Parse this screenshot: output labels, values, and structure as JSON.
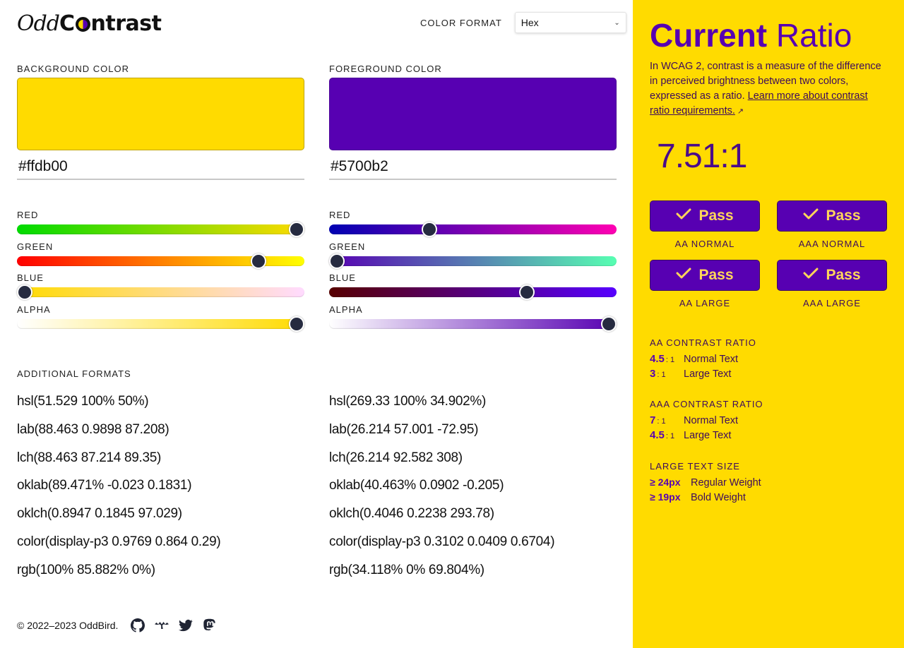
{
  "header": {
    "logo_part1": "Odd",
    "logo_part2_pre": "C",
    "logo_part2_post": "ntrast",
    "color_format_label": "COLOR FORMAT",
    "color_format_selected": "Hex"
  },
  "background": {
    "title": "BACKGROUND COLOR",
    "swatch_color": "#ffdb00",
    "hex_value": "#ffdb00",
    "sliders": [
      {
        "label": "RED",
        "value": 1.0,
        "gradient": [
          "#00db00",
          "#ffdb00"
        ]
      },
      {
        "label": "GREEN",
        "value": 0.859,
        "gradient": [
          "#ff0000",
          "#ffff00"
        ]
      },
      {
        "label": "BLUE",
        "value": 0.0,
        "gradient": [
          "#ffdb00",
          "#ffdbff"
        ]
      },
      {
        "label": "ALPHA",
        "value": 1.0,
        "gradient": [
          "rgba(255,219,0,0)",
          "#ffdb00"
        ]
      }
    ],
    "formats": [
      "hsl(51.529 100% 50%)",
      "lab(88.463 0.9898 87.208)",
      "lch(88.463 87.214 89.35)",
      "oklab(89.471% -0.023 0.1831)",
      "oklch(0.8947 0.1845 97.029)",
      "color(display-p3 0.9769 0.864 0.29)",
      "rgb(100% 85.882% 0%)"
    ]
  },
  "foreground": {
    "title": "FOREGROUND COLOR",
    "swatch_color": "#5700b2",
    "hex_value": "#5700b2",
    "sliders": [
      {
        "label": "RED",
        "value": 0.341,
        "gradient": [
          "#0000b2",
          "#ff00b2"
        ]
      },
      {
        "label": "GREEN",
        "value": 0.0,
        "gradient": [
          "#5700b2",
          "#57ffb2"
        ]
      },
      {
        "label": "BLUE",
        "value": 0.698,
        "gradient": [
          "#570000",
          "#5700ff"
        ]
      },
      {
        "label": "ALPHA",
        "value": 1.0,
        "gradient": [
          "rgba(87,0,178,0)",
          "#5700b2"
        ]
      }
    ],
    "formats": [
      "hsl(269.33 100% 34.902%)",
      "lab(26.214 57.001 -72.95)",
      "lch(26.214 92.582 308)",
      "oklab(40.463% 0.0902 -0.205)",
      "oklch(0.4046 0.2238 293.78)",
      "color(display-p3 0.3102 0.0409 0.6704)",
      "rgb(34.118% 0% 69.804%)"
    ]
  },
  "additional_formats_title": "ADDITIONAL FORMATS",
  "footer": {
    "copyright": "© 2022–2023 OddBird.",
    "icons": [
      "github-icon",
      "oddbird-icon",
      "twitter-icon",
      "mastodon-icon"
    ]
  },
  "sidebar": {
    "title_bold": "Current",
    "title_light": "Ratio",
    "description": "In WCAG 2, contrast is a measure of the difference in perceived brightness between two colors, expressed as a ratio.",
    "link_text": "Learn more about contrast ratio requirements.",
    "link_icon": "external-link-icon",
    "ratio": "7.51:1",
    "results": [
      {
        "status": "Pass",
        "label": "AA NORMAL"
      },
      {
        "status": "Pass",
        "label": "AAA NORMAL"
      },
      {
        "status": "Pass",
        "label": "AA LARGE"
      },
      {
        "status": "Pass",
        "label": "AAA LARGE"
      }
    ],
    "aa": {
      "title": "AA CONTRAST RATIO",
      "rows": [
        {
          "value": "4.5",
          "suffix": ": 1",
          "text": "Normal Text"
        },
        {
          "value": "3",
          "suffix": ": 1",
          "text": "Large Text"
        }
      ]
    },
    "aaa": {
      "title": "AAA CONTRAST RATIO",
      "rows": [
        {
          "value": "7",
          "suffix": ": 1",
          "text": "Normal Text"
        },
        {
          "value": "4.5",
          "suffix": ": 1",
          "text": "Large Text"
        }
      ]
    },
    "large_text": {
      "title": "LARGE TEXT SIZE",
      "rows": [
        {
          "value": "≥ 24px",
          "text": "Regular Weight"
        },
        {
          "value": "≥ 19px",
          "text": "Bold Weight"
        }
      ]
    }
  },
  "colors": {
    "brand_yellow": "#ffdb00",
    "brand_purple": "#5700b2",
    "pass_text": "#ffd65a",
    "thumb": "#262b40"
  }
}
